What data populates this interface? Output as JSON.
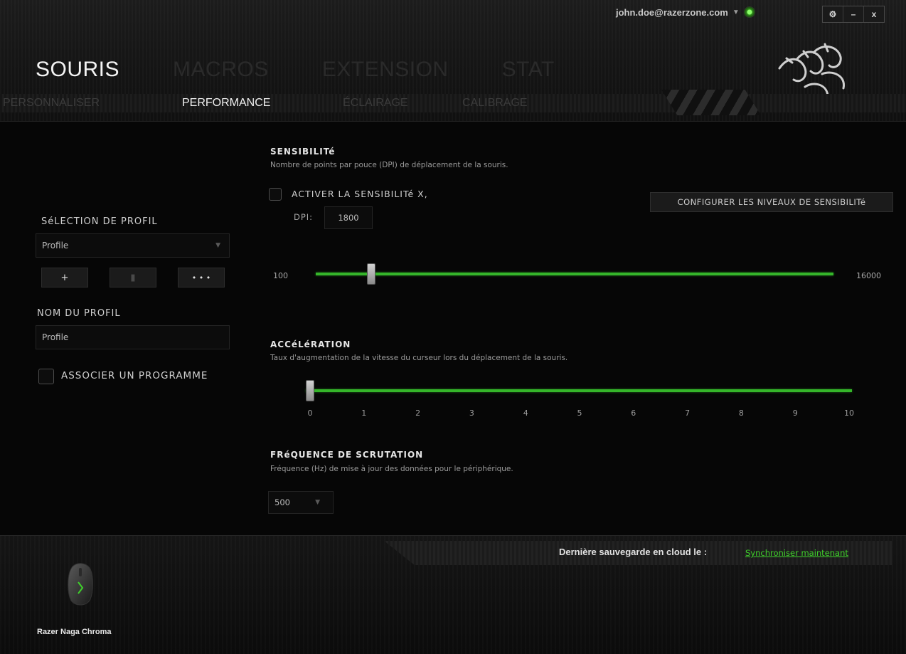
{
  "account": {
    "email": "john.doe@razerzone.com"
  },
  "window_controls": {
    "settings": "⚙",
    "minimize": "–",
    "close": "x"
  },
  "main_tabs": [
    "SOURIS",
    "MACROS",
    "EXTENSION",
    "STAT"
  ],
  "sub_tabs": [
    "PERSONNALISER",
    "PERFORMANCE",
    "ÉCLAIRAGE",
    "CALIBRAGE"
  ],
  "active_tab": "SOURIS",
  "active_sub_tab": "PERFORMANCE",
  "left_panel": {
    "profile_select_label": "SéLECTION DE PROFIL",
    "profile_selected": "Profile",
    "add_button": "+",
    "delete_button": "▮",
    "more_button": "• • •",
    "profile_name_label": "NOM DU PROFIL",
    "profile_name_value": "Profile",
    "associate_program_label": "ASSOCIER UN PROGRAMME"
  },
  "sensitivity": {
    "title": "SENSIBILITé",
    "description": "Nombre de points par pouce (DPI) de déplacement de la souris.",
    "enable_x_label": "ACTIVER LA SENSIBILITé X,",
    "dpi_label": "DPI:",
    "dpi_value": "1800",
    "config_button": "CONFIGURER LES NIVEAUX DE SENSIBILITé",
    "slider_min_label": "100",
    "slider_max_label": "16000",
    "slider_min": 100,
    "slider_max": 16000,
    "slider_value": 1800
  },
  "acceleration": {
    "title": "ACCéLéRATION",
    "description": "Taux d'augmentation de la vitesse du curseur lors du déplacement de la souris.",
    "ticks": [
      "0",
      "1",
      "2",
      "3",
      "4",
      "5",
      "6",
      "7",
      "8",
      "9",
      "10"
    ],
    "slider_min": 0,
    "slider_max": 10,
    "slider_value": 0
  },
  "polling": {
    "title": "FRéQUENCE DE SCRUTATION",
    "description": "Fréquence (Hz) de mise à jour des données pour le périphérique.",
    "selected": "500"
  },
  "footer": {
    "cloud_label": "Dernière sauvegarde en cloud le :",
    "sync_link": "Synchroniser maintenant",
    "device_name": "Razer Naga Chroma"
  },
  "colors": {
    "accent_green": "#35b52a",
    "link_green": "#3fd12b"
  }
}
